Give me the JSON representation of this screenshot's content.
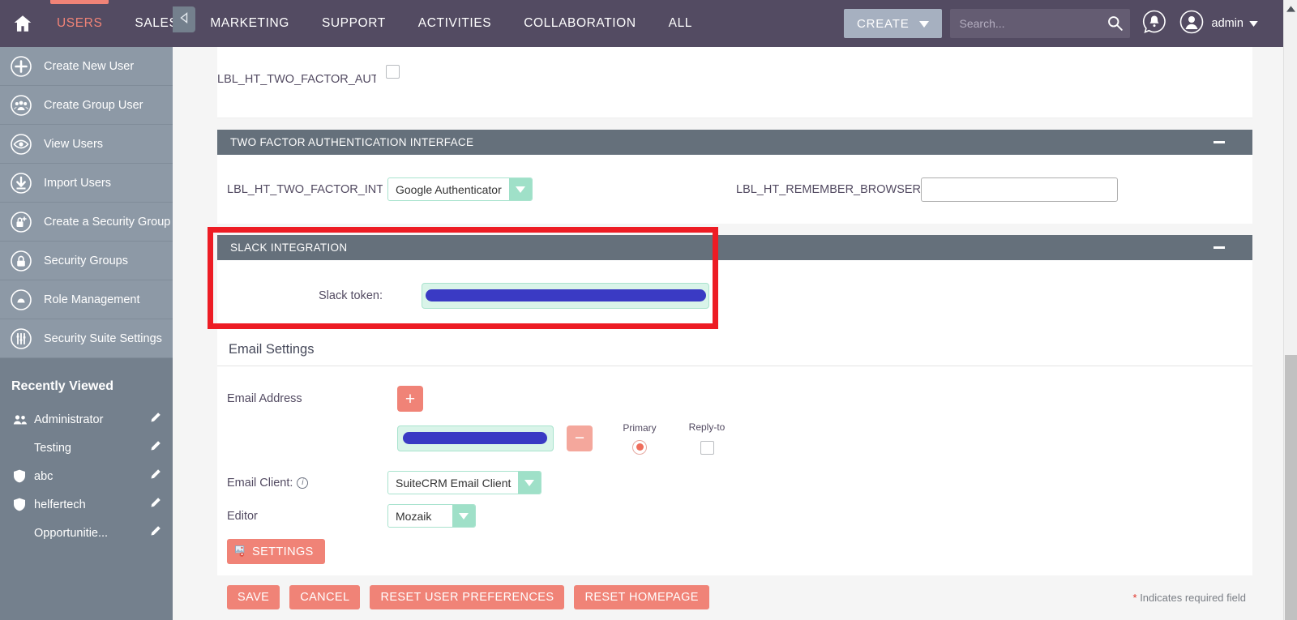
{
  "topnav": {
    "home_icon": "home-icon",
    "modules": [
      {
        "label": "USERS",
        "active": true
      },
      {
        "label": "SALES",
        "active": false
      },
      {
        "label": "MARKETING",
        "active": false
      },
      {
        "label": "SUPPORT",
        "active": false
      },
      {
        "label": "ACTIVITIES",
        "active": false
      },
      {
        "label": "COLLABORATION",
        "active": false
      },
      {
        "label": "ALL",
        "active": false
      }
    ],
    "create_label": "CREATE",
    "search_placeholder": "Search...",
    "search_value": "",
    "notifications_icon": "notification-bell-icon",
    "profile_icon": "user-avatar-icon",
    "admin_label": "admin",
    "accent_active": "#f08377",
    "navbar_bg": "#534b62"
  },
  "sidebar": {
    "items": [
      {
        "label": "Create New User",
        "icon": "plus-circle-icon"
      },
      {
        "label": "Create Group User",
        "icon": "group-users-icon"
      },
      {
        "label": "View Users",
        "icon": "eye-icon"
      },
      {
        "label": "Import Users",
        "icon": "download-arrow-icon"
      },
      {
        "label": "Create a Security Group",
        "icon": "lock-plus-icon"
      },
      {
        "label": "Security Groups",
        "icon": "lock-icon"
      },
      {
        "label": "Role Management",
        "icon": "role-icon"
      },
      {
        "label": "Security Suite Settings",
        "icon": "sliders-icon"
      }
    ],
    "recent_title": "Recently Viewed",
    "recent_items": [
      {
        "label": "Administrator",
        "icon": "users-icon",
        "edit_icon": "pencil-icon"
      },
      {
        "label": "Testing",
        "icon": "",
        "edit_icon": "pencil-icon"
      },
      {
        "label": "abc",
        "icon": "shield-icon",
        "edit_icon": "pencil-icon"
      },
      {
        "label": "helfertech",
        "icon": "shield-icon",
        "edit_icon": "pencil-icon"
      },
      {
        "label": "Opportunitie...",
        "icon": "",
        "edit_icon": "pencil-icon"
      }
    ],
    "collapse_icon": "collapse-left-icon"
  },
  "main": {
    "two_factor_auth": {
      "label": "LBL_HT_TWO_FACTOR_AUTH:",
      "checked": false
    },
    "two_factor_panel": {
      "title": "TWO FACTOR AUTHENTICATION INTERFACE",
      "collapse_icon": "minus-icon",
      "interface_label": "LBL_HT_TWO_FACTOR_INTERFA",
      "interface_value": "Google Authenticator",
      "remember_browser_label": "LBL_HT_REMEMBER_BROWSER",
      "remember_browser_value": ""
    },
    "slack_panel": {
      "title": "SLACK INTEGRATION",
      "collapse_icon": "minus-icon",
      "token_label": "Slack token:",
      "token_value": "",
      "token_redacted": true,
      "highlight_color": "#ed1c24"
    },
    "email_settings": {
      "title": "Email Settings",
      "email_address_label": "Email Address",
      "add_button": "+",
      "remove_button": "−",
      "email_value": "",
      "email_redacted": true,
      "primary_label": "Primary",
      "primary_selected": true,
      "replyto_label": "Reply-to",
      "replyto_checked": false,
      "email_client_label": "Email Client:",
      "email_client_info_icon": "info-icon",
      "email_client_value": "SuiteCRM Email Client",
      "editor_label": "Editor",
      "editor_value": "Mozaik",
      "settings_button": "SETTINGS",
      "settings_icon": "broken-image-icon"
    },
    "footer": {
      "buttons": [
        "SAVE",
        "CANCEL",
        "RESET USER PREFERENCES",
        "RESET HOMEPAGE"
      ],
      "required_star": "*",
      "required_note": "Indicates required field"
    }
  },
  "scrollbar": {
    "up_icon": "scroll-up-arrow-icon"
  }
}
